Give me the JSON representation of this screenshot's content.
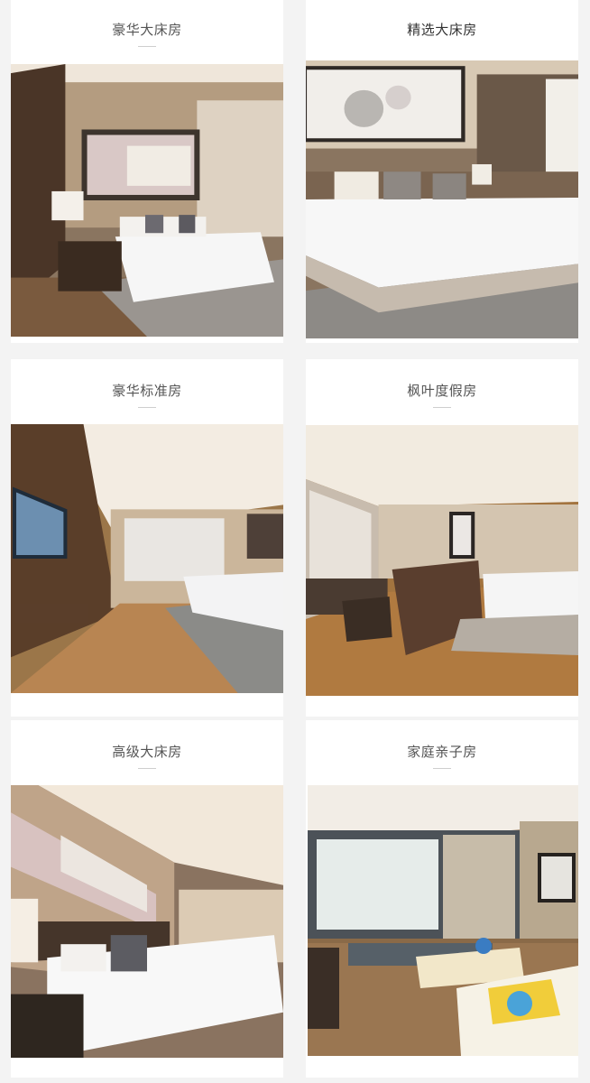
{
  "rooms": [
    {
      "name": "豪华大床房",
      "photo_icon": "hotel-room-photo"
    },
    {
      "name": "精选大床房",
      "photo_icon": "hotel-room-photo"
    },
    {
      "name": "豪华标准房",
      "photo_icon": "hotel-room-photo"
    },
    {
      "name": "枫叶度假房",
      "photo_icon": "hotel-room-photo"
    },
    {
      "name": "高级大床房",
      "photo_icon": "hotel-room-photo"
    },
    {
      "name": "家庭亲子房",
      "photo_icon": "hotel-room-photo"
    }
  ]
}
